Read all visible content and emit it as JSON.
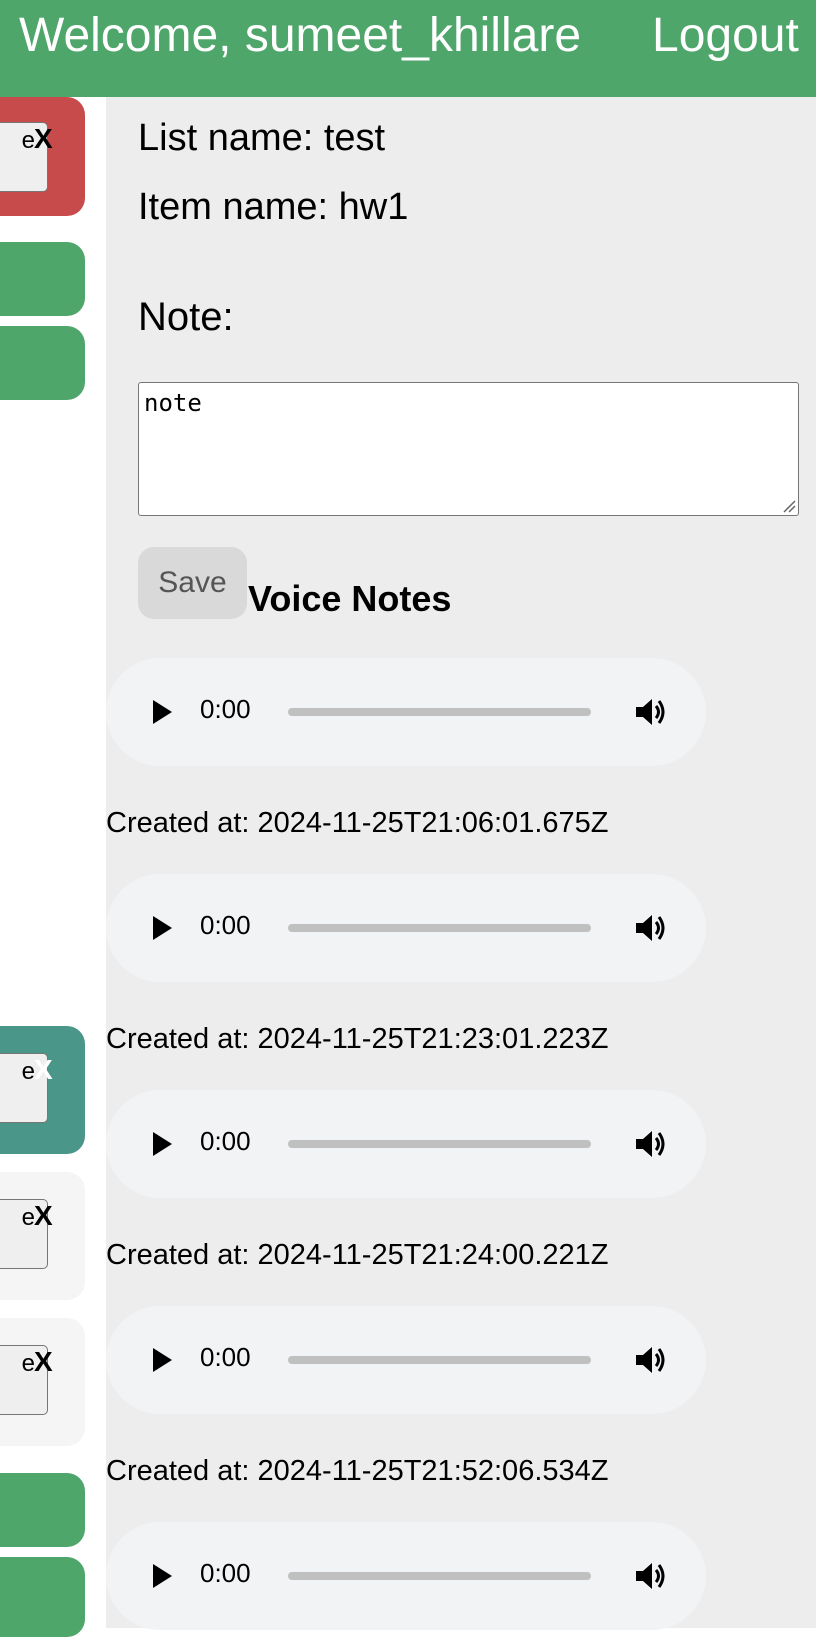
{
  "header": {
    "welcome": "Welcome, sumeet_khillare",
    "logout": "Logout",
    "color": "#4fa66b"
  },
  "sidebar": {
    "button_fragment": "e",
    "close_label": "X",
    "card_colors": [
      "#c84b4b",
      "#4fa66b",
      "#4fa66b",
      "#4a9789",
      "#f5f5f5",
      "#f5f5f5",
      "#4fa66b",
      "#4fa66b"
    ]
  },
  "details": {
    "list_name": "List name: test",
    "item_name": "Item name: hw1",
    "note_label": "Note:",
    "note_value": "note",
    "save_label": "Save",
    "voice_notes_title": "Voice Notes"
  },
  "voice_notes": [
    {
      "time": "0:00",
      "created": "Created at: 2024-11-25T21:06:01.675Z"
    },
    {
      "time": "0:00",
      "created": "Created at: 2024-11-25T21:23:01.223Z"
    },
    {
      "time": "0:00",
      "created": "Created at: 2024-11-25T21:24:00.221Z"
    },
    {
      "time": "0:00",
      "created": "Created at: 2024-11-25T21:52:06.534Z"
    },
    {
      "time": "0:00",
      "created": ""
    }
  ],
  "icons": {
    "play": "play-icon",
    "volume": "volume-icon",
    "close": "close-icon"
  }
}
